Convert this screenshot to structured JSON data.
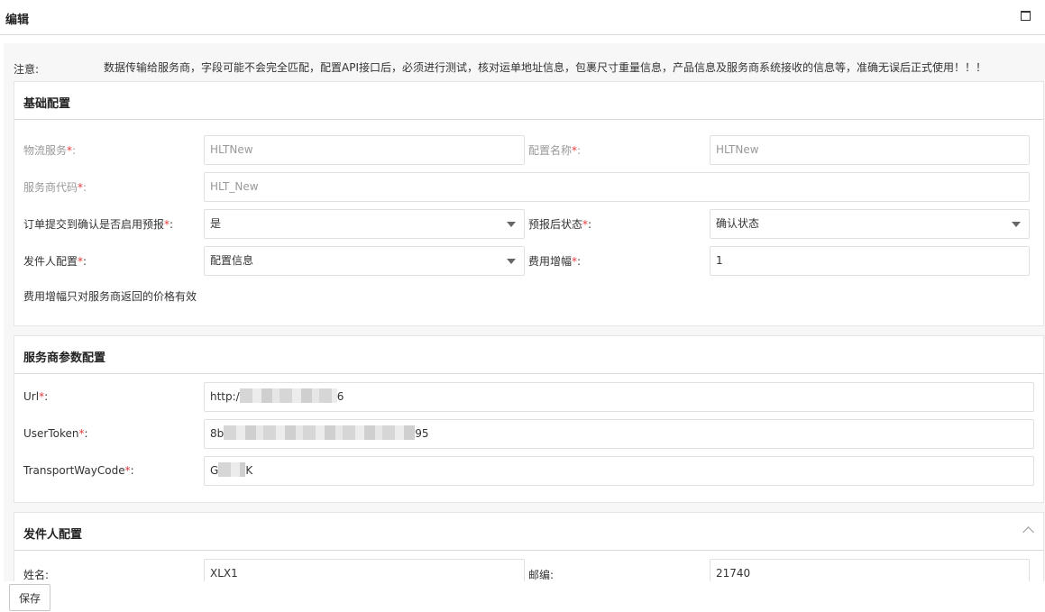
{
  "window": {
    "title": "编辑"
  },
  "notice": {
    "label": "注意:",
    "text": "数据传输给服务商，字段可能不会完全匹配，配置API接口后，必须进行测试，核对运单地址信息，包裹尺寸重量信息，产品信息及服务商系统接收的信息等，准确无误后正式使用！！！"
  },
  "basic": {
    "title": "基础配置",
    "logistics_label": "物流服务",
    "logistics_value": "HLTNew",
    "config_name_label": "配置名称",
    "config_name_value": "HLTNew",
    "provider_code_label": "服务商代码",
    "provider_code_value": "HLT_New",
    "prereport_label": "订单提交到确认是否启用预报",
    "prereport_value": "是",
    "after_status_label": "预报后状态",
    "after_status_value": "确认状态",
    "sender_config_label": "发件人配置",
    "sender_config_value": "配置信息",
    "fee_increase_label": "费用增幅",
    "fee_increase_value": "1",
    "hint": "费用增幅只对服务商返回的价格有效",
    "required_mark": "*",
    "colon": ":"
  },
  "provider": {
    "title": "服务商参数配置",
    "url_label": "Url",
    "url_prefix": "http:/",
    "url_suffix": "6",
    "token_label": "UserToken",
    "token_prefix": "8b",
    "token_suffix": "95",
    "transport_label": "TransportWayCode",
    "transport_prefix": "G",
    "transport_suffix": "K"
  },
  "sender": {
    "title": "发件人配置",
    "name_label": "姓名",
    "name_value": "XLX1",
    "zip_label": "邮编",
    "zip_value": "21740"
  },
  "footer": {
    "save_label": "保存"
  }
}
